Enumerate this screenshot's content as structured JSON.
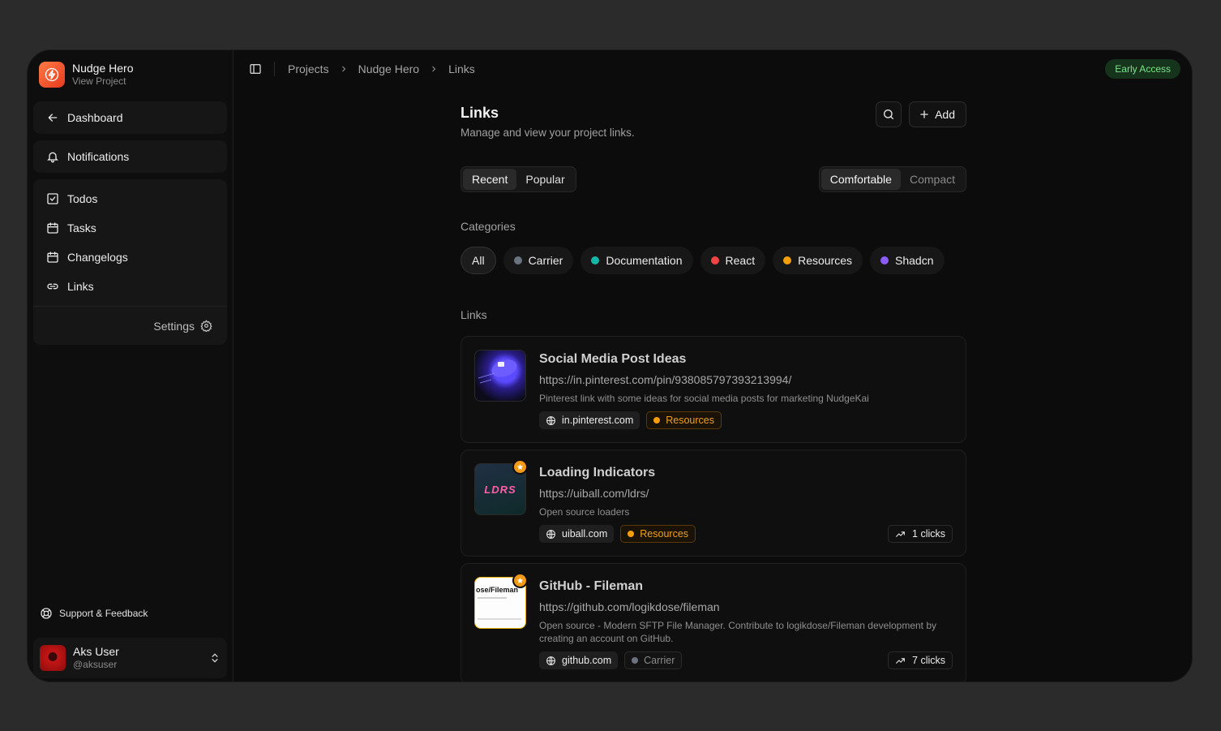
{
  "project": {
    "name": "Nudge Hero",
    "sub": "View Project"
  },
  "sidebar": {
    "dashboard": "Dashboard",
    "notifications": "Notifications",
    "items": [
      {
        "label": "Todos",
        "icon": "check-square-icon"
      },
      {
        "label": "Tasks",
        "icon": "calendar-icon"
      },
      {
        "label": "Changelogs",
        "icon": "calendar-icon"
      },
      {
        "label": "Links",
        "icon": "link-icon"
      }
    ],
    "settings": "Settings",
    "support": "Support & Feedback",
    "user": {
      "name": "Aks User",
      "handle": "@aksuser"
    }
  },
  "breadcrumb": [
    "Projects",
    "Nudge Hero",
    "Links"
  ],
  "badge": "Early Access",
  "page": {
    "title": "Links",
    "subtitle": "Manage and view your project links.",
    "add": "Add"
  },
  "sort_tabs": [
    {
      "label": "Recent",
      "active": true
    },
    {
      "label": "Popular",
      "active": false
    }
  ],
  "view_tabs": [
    {
      "label": "Comfortable",
      "active": true
    },
    {
      "label": "Compact",
      "active": false
    }
  ],
  "categories_label": "Categories",
  "categories": [
    {
      "label": "All",
      "color": ""
    },
    {
      "label": "Carrier",
      "color": "#6b7280"
    },
    {
      "label": "Documentation",
      "color": "#14b8a6"
    },
    {
      "label": "React",
      "color": "#ef4444"
    },
    {
      "label": "Resources",
      "color": "#f59e0b"
    },
    {
      "label": "Shadcn",
      "color": "#8b5cf6"
    }
  ],
  "links_label": "Links",
  "links": [
    {
      "title": "Social Media Post Ideas",
      "url": "https://in.pinterest.com/pin/938085797393213994/",
      "description": "Pinterest link with some ideas for social media posts for marketing NudgeKai",
      "domain": "in.pinterest.com",
      "category": "Resources",
      "starred": false,
      "clicks": ""
    },
    {
      "title": "Loading Indicators",
      "url": "https://uiball.com/ldrs/",
      "description": "Open source loaders",
      "domain": "uiball.com",
      "category": "Resources",
      "starred": true,
      "clicks": "1 clicks",
      "thumb_text": "LDRS"
    },
    {
      "title": "GitHub - Fileman",
      "url": "https://github.com/logikdose/fileman",
      "description": "Open source - Modern SFTP File Manager. Contribute to logikdose/Fileman development by creating an account on GitHub.",
      "domain": "github.com",
      "category": "Carrier",
      "starred": true,
      "clicks": "7 clicks",
      "thumb_text": "ose/Fileman"
    }
  ]
}
